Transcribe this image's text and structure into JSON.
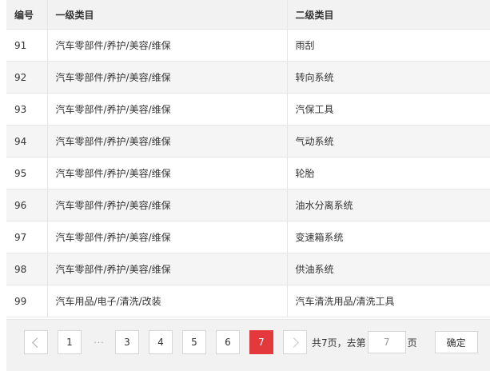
{
  "table": {
    "headers": [
      "编号",
      "一级类目",
      "二级类目"
    ],
    "rows": [
      {
        "id": "91",
        "level1": "汽车零部件/养护/美容/维保",
        "level2": "雨刮"
      },
      {
        "id": "92",
        "level1": "汽车零部件/养护/美容/维保",
        "level2": "转向系统"
      },
      {
        "id": "93",
        "level1": "汽车零部件/养护/美容/维保",
        "level2": "汽保工具"
      },
      {
        "id": "94",
        "level1": "汽车零部件/养护/美容/维保",
        "level2": "气动系统"
      },
      {
        "id": "95",
        "level1": "汽车零部件/养护/美容/维保",
        "level2": "轮胎"
      },
      {
        "id": "96",
        "level1": "汽车零部件/养护/美容/维保",
        "level2": "油水分离系统"
      },
      {
        "id": "97",
        "level1": "汽车零部件/养护/美容/维保",
        "level2": "变速箱系统"
      },
      {
        "id": "98",
        "level1": "汽车零部件/养护/美容/维保",
        "level2": "供油系统"
      },
      {
        "id": "99",
        "level1": "汽车用品/电子/清洗/改装",
        "level2": "汽车清洗用品/清洗工具"
      }
    ]
  },
  "pagination": {
    "prev_icon": "chevron-left-icon",
    "next_icon": "chevron-right-icon",
    "first_page": "1",
    "ellipsis": "···",
    "pages": [
      "3",
      "4",
      "5",
      "6"
    ],
    "current_page": "7",
    "total_text": "共7页，去第",
    "goto_value": "7",
    "goto_suffix": "页",
    "confirm_label": "确定",
    "active_color": "#e4393c"
  }
}
